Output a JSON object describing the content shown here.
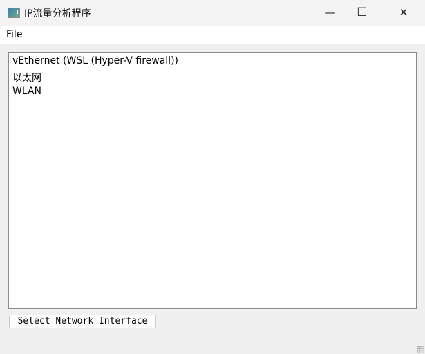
{
  "window": {
    "title": "IP流量分析程序",
    "minimize": "—",
    "maximize": "☐",
    "close": "✕"
  },
  "menu": {
    "file": "File"
  },
  "interfaces": [
    "vEthernet (WSL (Hyper-V firewall))",
    "以太网",
    "WLAN"
  ],
  "actions": {
    "select_label": "Select Network Interface"
  }
}
